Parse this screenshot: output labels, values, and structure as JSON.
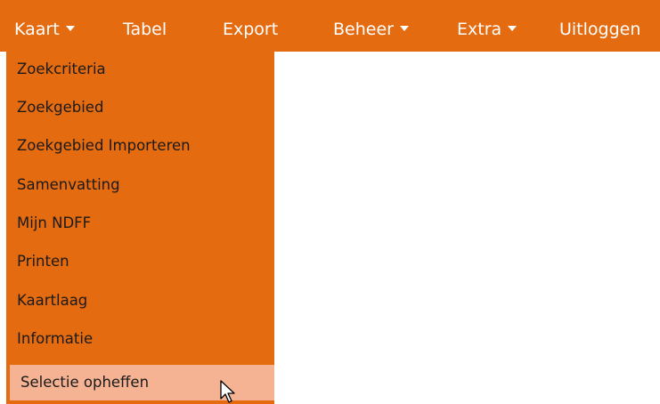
{
  "menubar": {
    "items": [
      {
        "label": "Kaart",
        "has_caret": true
      },
      {
        "label": "Tabel",
        "has_caret": false
      },
      {
        "label": "Export",
        "has_caret": false
      },
      {
        "label": "Beheer",
        "has_caret": true
      },
      {
        "label": "Extra",
        "has_caret": true
      },
      {
        "label": "Uitloggen",
        "has_caret": false
      }
    ]
  },
  "kaart_menu": {
    "items": [
      "Zoekcriteria",
      "Zoekgebied",
      "Zoekgebied Importeren",
      "Samenvatting",
      "Mijn NDFF",
      "Printen",
      "Kaartlaag",
      "Informatie",
      "Selectie opheffen"
    ],
    "hovered": "Selectie opheffen"
  },
  "colors": {
    "menu_bg": "#e56b10",
    "hover_bg": "#f5b394",
    "menubar_text": "#ffffff",
    "dropdown_text": "#1a1a1a"
  },
  "cursor_icon": "arrow-pointer-icon"
}
